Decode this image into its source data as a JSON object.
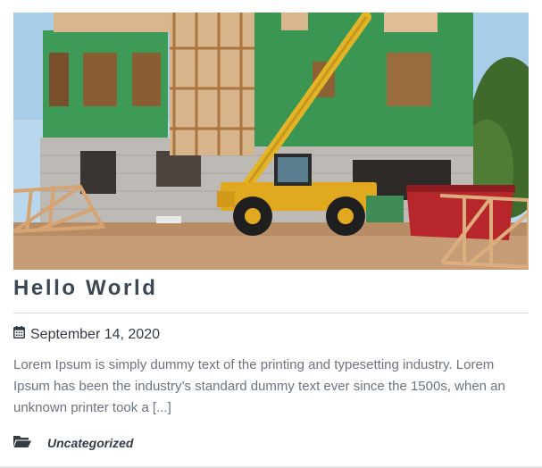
{
  "post": {
    "title": "Hello World",
    "date": "September 14, 2020",
    "excerpt": "Lorem Ipsum is simply dummy text of the printing and typesetting industry. Lorem Ipsum has been the industry’s standard dummy text ever since the 1500s, when an unknown printer took a [...]",
    "category": "Uncategorized",
    "date_icon": "calendar-icon",
    "category_icon": "folder-open-icon"
  },
  "colors": {
    "title": "#3b4753",
    "text": "#6b7480",
    "meta": "#333b44",
    "divider": "#d5d8dc"
  }
}
